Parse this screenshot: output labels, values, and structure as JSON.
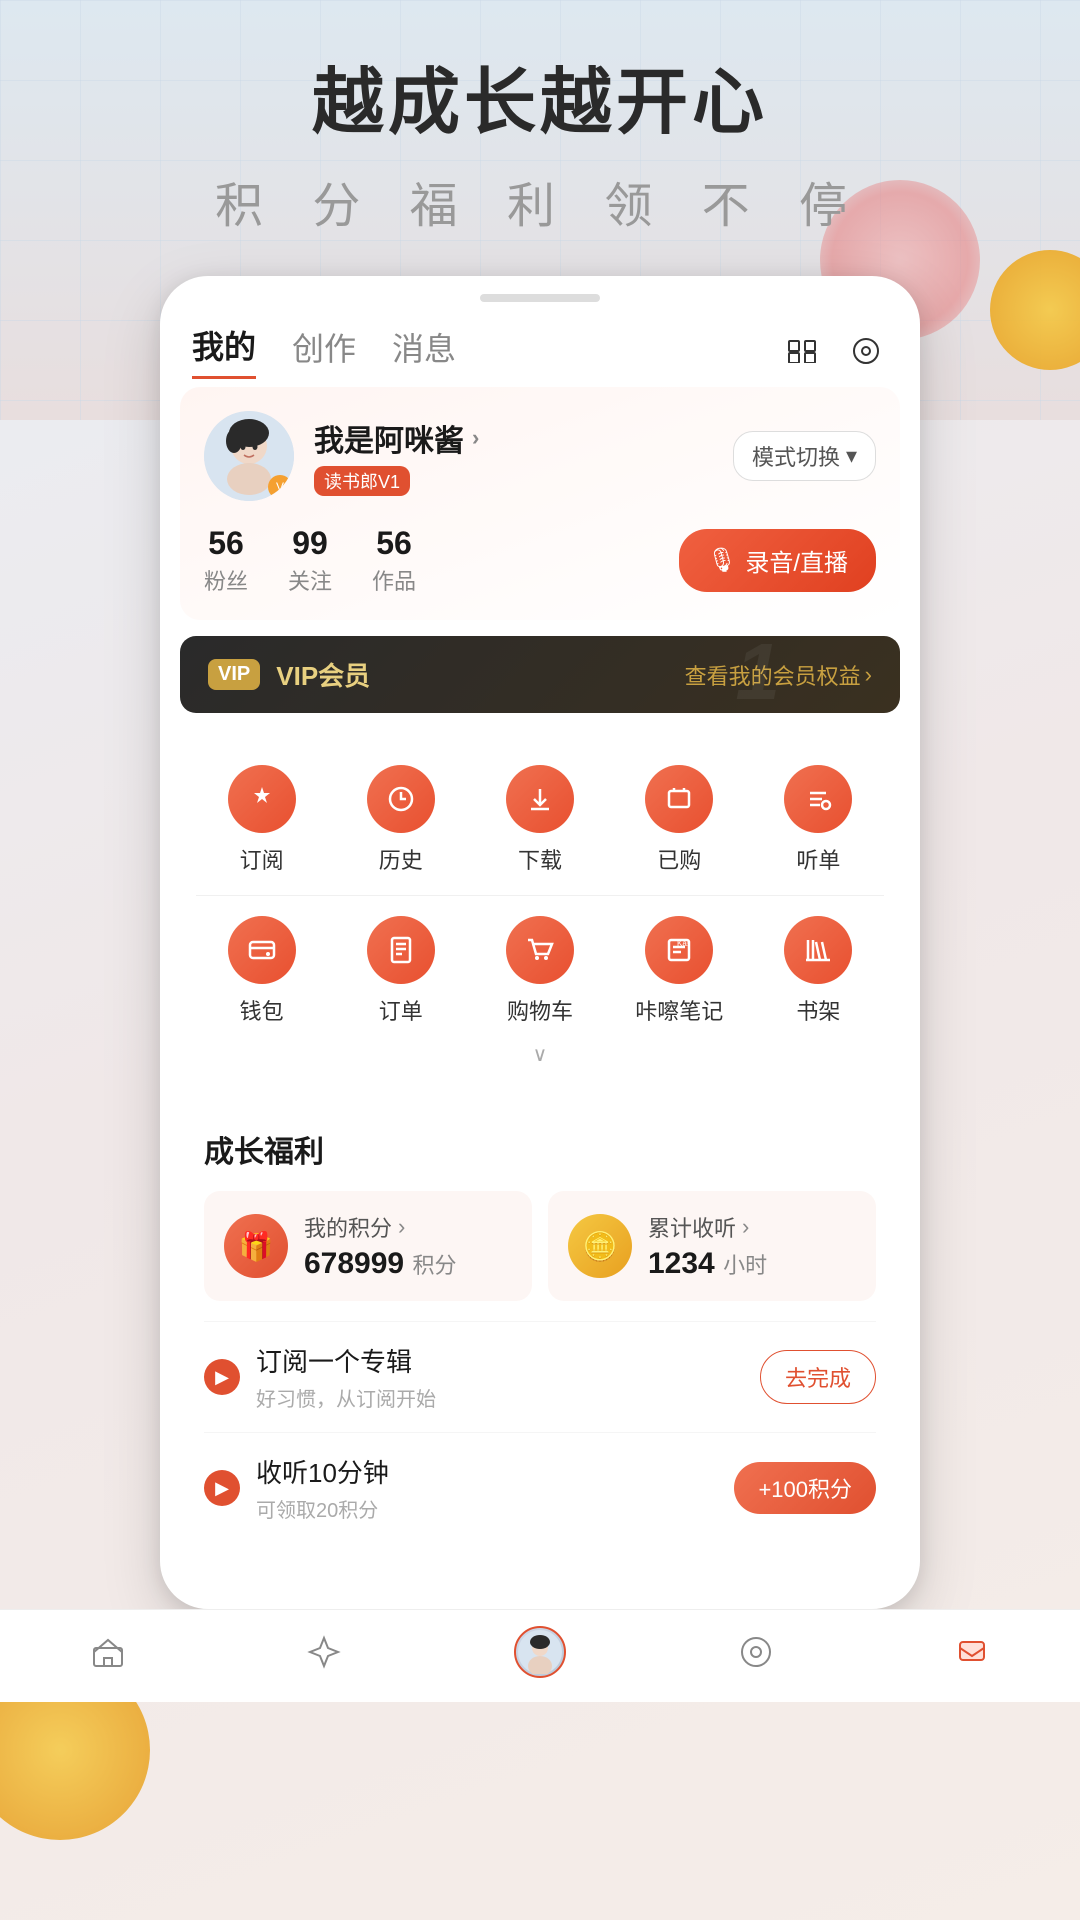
{
  "hero": {
    "title": "越成长越开心",
    "subtitle": "积 分 福 利 领 不 停"
  },
  "tabs": {
    "items": [
      {
        "label": "我的",
        "active": true
      },
      {
        "label": "创作",
        "active": false
      },
      {
        "label": "消息",
        "active": false
      }
    ],
    "expand_icon": "⊡",
    "settings_icon": "◎"
  },
  "profile": {
    "name": "我是阿咪酱",
    "tag": "读书郎V1",
    "mode_switch": "模式切换",
    "stats": {
      "fans": {
        "value": "56",
        "label": "粉丝"
      },
      "following": {
        "value": "99",
        "label": "关注"
      },
      "works": {
        "value": "56",
        "label": "作品"
      }
    },
    "record_btn": "录音/直播"
  },
  "vip": {
    "badge": "VIP",
    "text": "VIP会员",
    "right_text": "查看我的会员权益",
    "bg_number": "1"
  },
  "menu": {
    "row1": [
      {
        "icon": "★",
        "label": "订阅"
      },
      {
        "icon": "↺",
        "label": "历史"
      },
      {
        "icon": "↓",
        "label": "下载"
      },
      {
        "icon": "☑",
        "label": "已购"
      },
      {
        "icon": "♪",
        "label": "听单"
      }
    ],
    "row2": [
      {
        "icon": "💰",
        "label": "钱包"
      },
      {
        "icon": "📋",
        "label": "订单"
      },
      {
        "icon": "🛒",
        "label": "购物车"
      },
      {
        "icon": "Ka!",
        "label": "咔嚓笔记"
      },
      {
        "icon": "📚",
        "label": "书架"
      }
    ],
    "expand": "∨"
  },
  "growth": {
    "title": "成长福利",
    "cards": [
      {
        "icon": "🎁",
        "title": "我的积分",
        "value": "678999",
        "unit": "积分",
        "icon_type": "red"
      },
      {
        "icon": "🪙",
        "title": "累计收听",
        "value": "1234",
        "unit": "小时",
        "icon_type": "yellow"
      }
    ],
    "tasks": [
      {
        "icon": "▶",
        "title": "订阅一个专辑",
        "subtitle": "好习惯，从订阅开始",
        "btn_label": "去完成",
        "btn_type": "outline"
      },
      {
        "icon": "▶",
        "title": "收听10分钟",
        "subtitle": "可领取20积分",
        "btn_label": "+100积分",
        "btn_type": "filled"
      }
    ]
  },
  "bottom_nav": {
    "items": [
      {
        "icon": "📊",
        "label": "",
        "active": false,
        "type": "chart"
      },
      {
        "icon": "☆",
        "label": "",
        "active": false,
        "type": "star"
      },
      {
        "icon": "avatar",
        "label": "",
        "active": true,
        "type": "avatar"
      },
      {
        "icon": "◎",
        "label": "",
        "active": false,
        "type": "discover"
      },
      {
        "icon": "🔔",
        "label": "",
        "active": false,
        "type": "notify"
      }
    ]
  }
}
